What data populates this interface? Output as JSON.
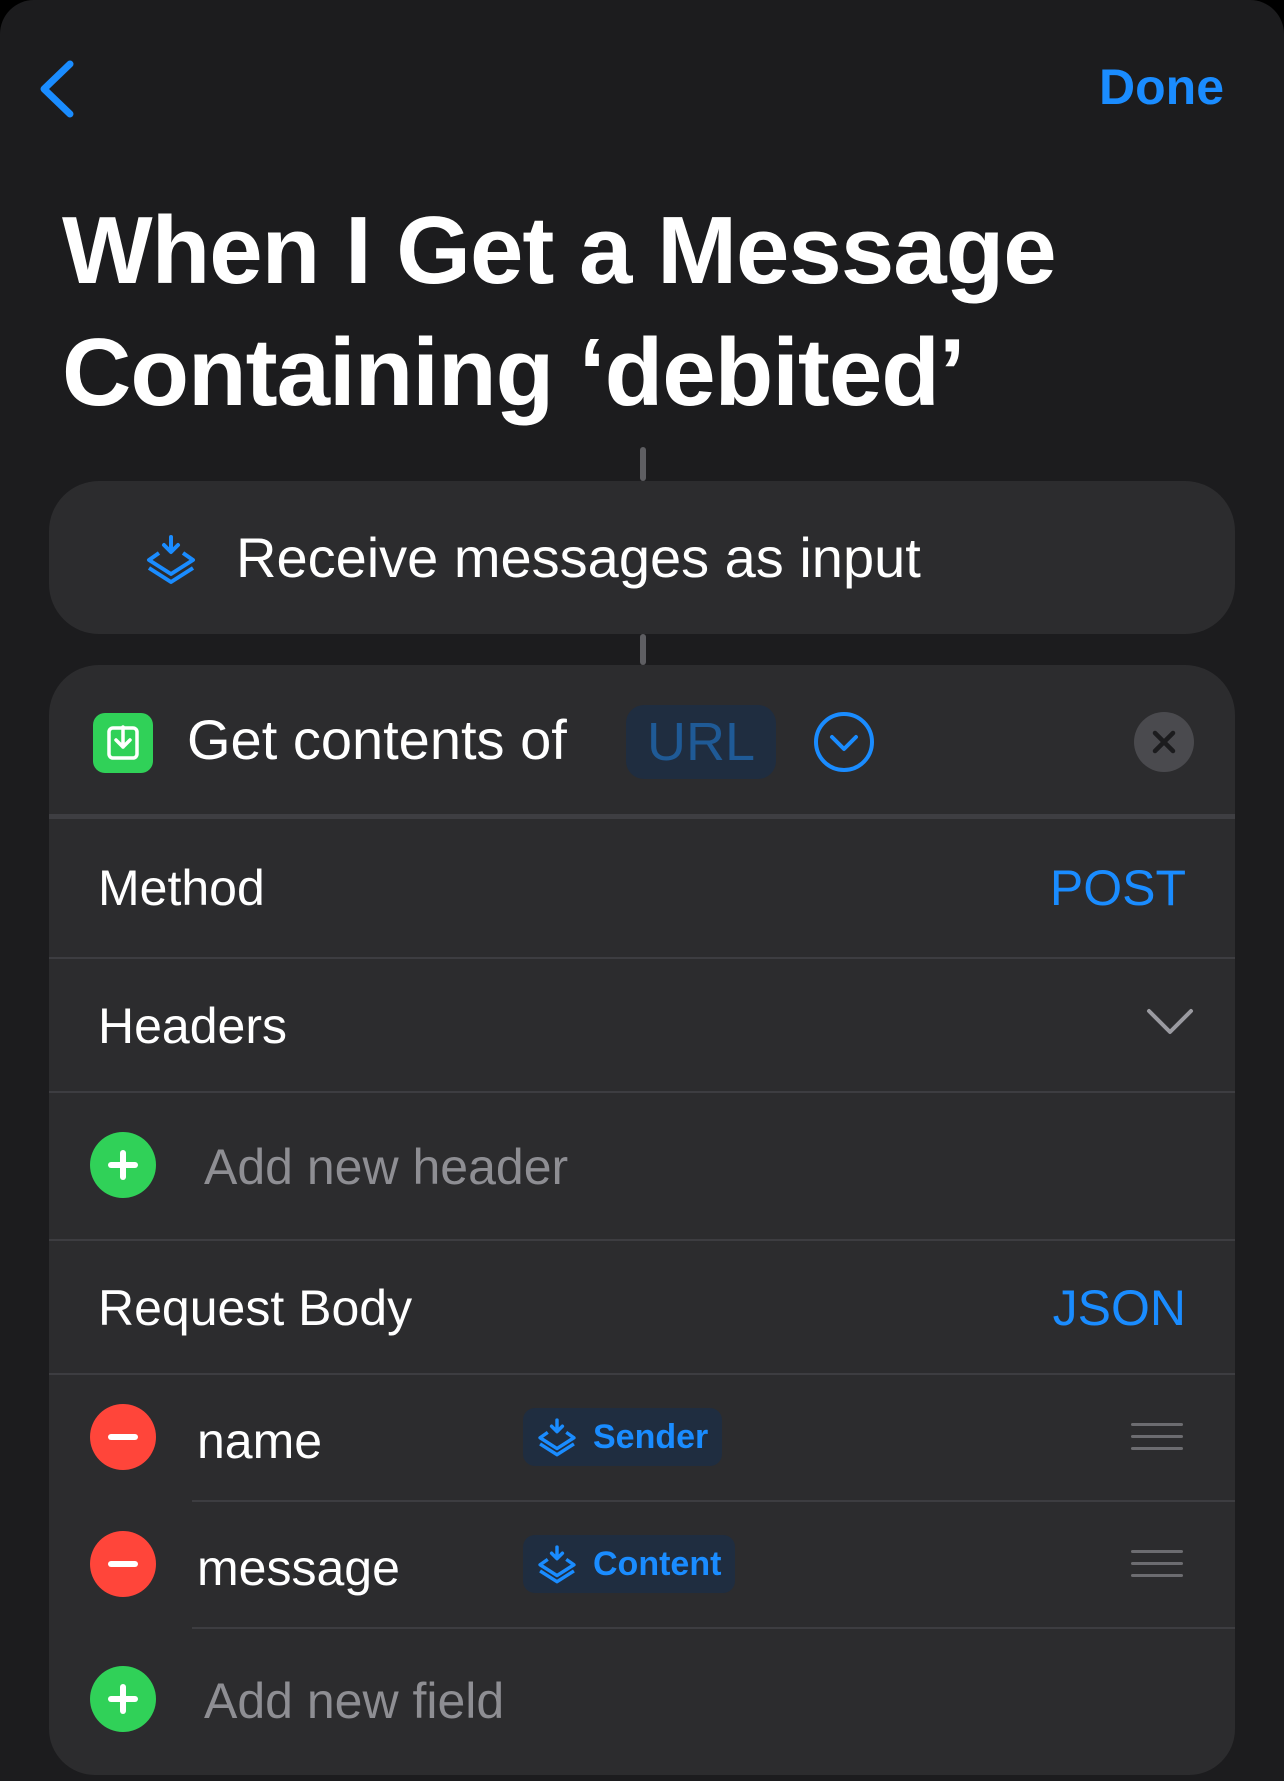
{
  "nav": {
    "done_label": "Done"
  },
  "title": "When I Get a Message Containing ‘debited’",
  "trigger": {
    "label": "Receive messages as input"
  },
  "action": {
    "prefix": "Get contents of",
    "url_placeholder": "URL",
    "method": {
      "label": "Method",
      "value": "POST"
    },
    "headers": {
      "label": "Headers",
      "add_placeholder": "Add new header"
    },
    "request_body": {
      "label": "Request Body",
      "value": "JSON"
    },
    "fields": [
      {
        "key": "name",
        "variable": "Sender"
      },
      {
        "key": "message",
        "variable": "Content"
      }
    ],
    "add_field_placeholder": "Add new field"
  },
  "colors": {
    "accent": "#1a8cff",
    "add": "#30d158",
    "remove": "#ff453a",
    "card": "#2c2c2e",
    "background": "#1c1c1e"
  }
}
